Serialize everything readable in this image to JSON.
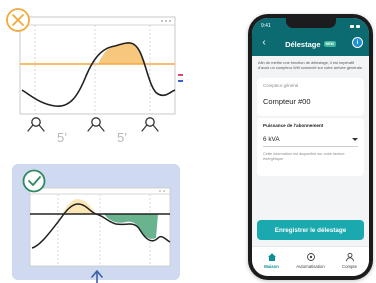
{
  "illustrations": {
    "top": {
      "status": "not-allowed",
      "status_icon": "x-circle-icon",
      "interval_labels": [
        "5’",
        "5’"
      ],
      "zoom_icons": [
        "magnifier-icon",
        "magnifier-icon",
        "magnifier-icon"
      ],
      "accent_color": "#f2a93b"
    },
    "bottom": {
      "status": "allowed",
      "status_icon": "check-circle-icon",
      "arrow_icon": "arrow-up-icon",
      "panel_color": "#cfd9f0",
      "accent_color": "#2e8a5f"
    }
  },
  "phone": {
    "status_time": "9:41",
    "header": {
      "title": "Délestage",
      "badge": "NEW",
      "back_icon": "chevron-left-icon",
      "info_icon": "info-icon"
    },
    "description": "Afin de mettre une fonction de délestage, il est impératif d'avoir un compteur Wifi connecté sur votre arrivée générale.",
    "meter": {
      "label": "Compteur général",
      "value": "Compteur #00"
    },
    "subscription": {
      "label": "Puissance de l'abonnement",
      "value": "6 kVA",
      "helper": "Cette information est disponible sur votre facture énergétique"
    },
    "save_button": "Enregistrer le délestage",
    "nav": [
      {
        "label": "Maison",
        "icon": "home-icon",
        "active": true
      },
      {
        "label": "Automatisation",
        "icon": "automation-icon",
        "active": false
      },
      {
        "label": "Compte",
        "icon": "user-icon",
        "active": false
      }
    ],
    "colors": {
      "header": "#0c6a71",
      "primary_button": "#1aa9ae",
      "active_nav": "#0c8f96"
    }
  }
}
